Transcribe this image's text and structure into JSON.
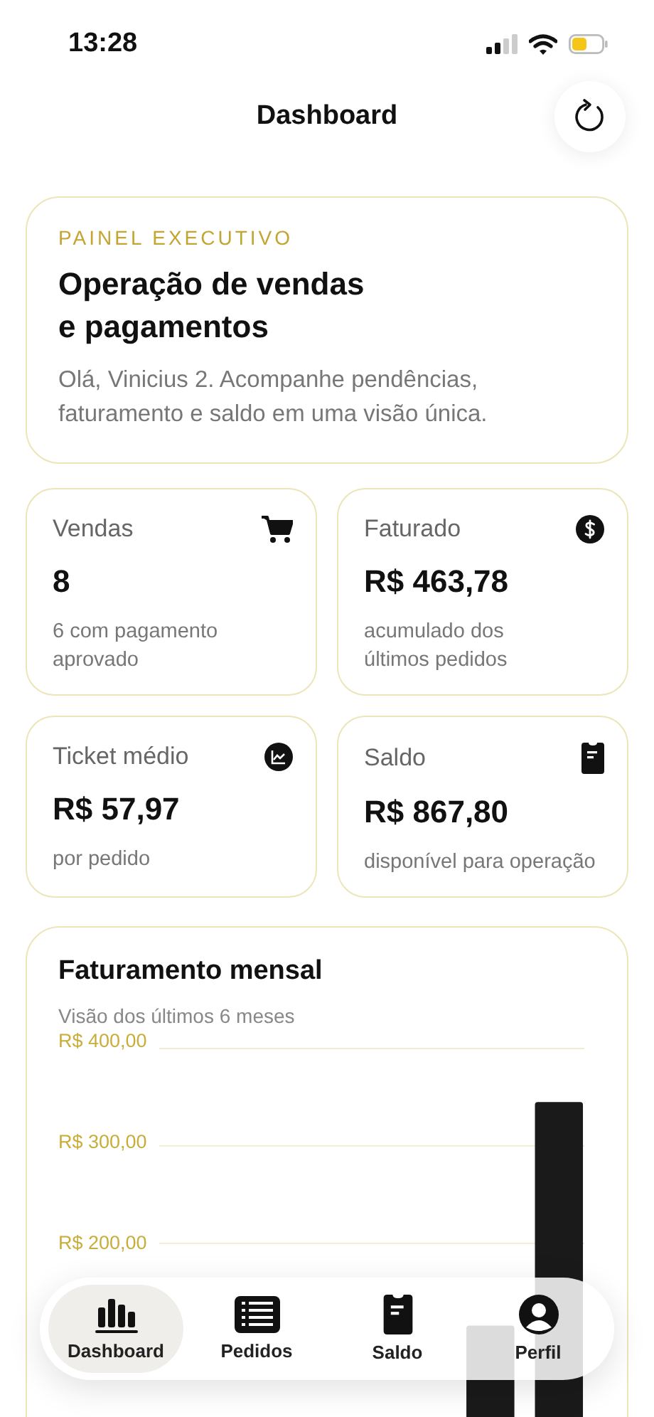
{
  "status_bar": {
    "time": "13:28"
  },
  "header": {
    "title": "Dashboard"
  },
  "hero": {
    "eyebrow": "PAINEL EXECUTIVO",
    "title": "Operação de vendas\ne pagamentos",
    "subtitle": "Olá, Vinicius 2. Acompanhe pendências, faturamento e saldo em uma visão única."
  },
  "stats": [
    {
      "label": "Vendas",
      "value": "8",
      "note": "6 com pagamento\naprovado",
      "kind": "cart"
    },
    {
      "label": "Faturado",
      "value": "R$ 463,78",
      "note": "acumulado dos\núltimos pedidos",
      "kind": "dollar"
    },
    {
      "label": "Ticket médio",
      "value": "R$ 57,97",
      "note": "por pedido",
      "kind": "chart"
    },
    {
      "label": "Saldo",
      "value": "R$ 867,80",
      "note": "disponível para operação",
      "kind": "clipboard"
    }
  ],
  "chart_card": {
    "title": "Faturamento mensal",
    "subtitle": "Visão dos últimos 6 meses",
    "axis_labels": [
      "R$ 400,00",
      "R$ 300,00",
      "R$ 200,00"
    ]
  },
  "tab_bar": [
    {
      "label": "Dashboard",
      "kind": "bars",
      "selected": true
    },
    {
      "label": "Pedidos",
      "kind": "list",
      "selected": false
    },
    {
      "label": "Saldo",
      "kind": "clipboard",
      "selected": false
    },
    {
      "label": "Perfil",
      "kind": "person",
      "selected": false
    }
  ]
}
